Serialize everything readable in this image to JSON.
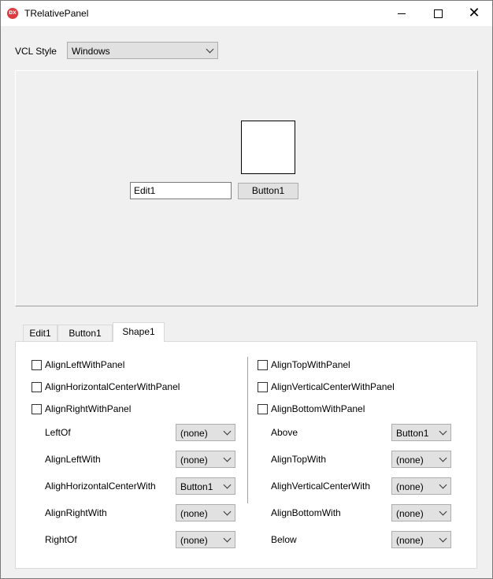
{
  "window": {
    "icon_text": "DX",
    "title": "TRelativePanel"
  },
  "toolbar": {
    "vcl_label": "VCL Style",
    "vcl_value": "Windows"
  },
  "panel": {
    "edit_value": "Edit1",
    "button_label": "Button1"
  },
  "tabs": [
    {
      "label": "Edit1"
    },
    {
      "label": "Button1"
    },
    {
      "label": "Shape1"
    }
  ],
  "left_checks": [
    {
      "label": "AlignLeftWithPanel"
    },
    {
      "label": "AlignHorizontalCenterWithPanel"
    },
    {
      "label": "AlignRightWithPanel"
    }
  ],
  "right_checks": [
    {
      "label": "AlignTopWithPanel"
    },
    {
      "label": "AlignVerticalCenterWithPanel"
    },
    {
      "label": "AlignBottomWithPanel"
    }
  ],
  "left_combos": [
    {
      "label": "LeftOf",
      "value": "(none)"
    },
    {
      "label": "AlignLeftWith",
      "value": "(none)"
    },
    {
      "label": "AlighHorizontalCenterWith",
      "value": "Button1"
    },
    {
      "label": "AlignRightWith",
      "value": "(none)"
    },
    {
      "label": "RightOf",
      "value": "(none)"
    }
  ],
  "right_combos": [
    {
      "label": "Above",
      "value": "Button1"
    },
    {
      "label": "AlignTopWith",
      "value": "(none)"
    },
    {
      "label": "AlighVerticalCenterWith",
      "value": "(none)"
    },
    {
      "label": "AlignBottomWith",
      "value": "(none)"
    },
    {
      "label": "Below",
      "value": "(none)"
    }
  ]
}
